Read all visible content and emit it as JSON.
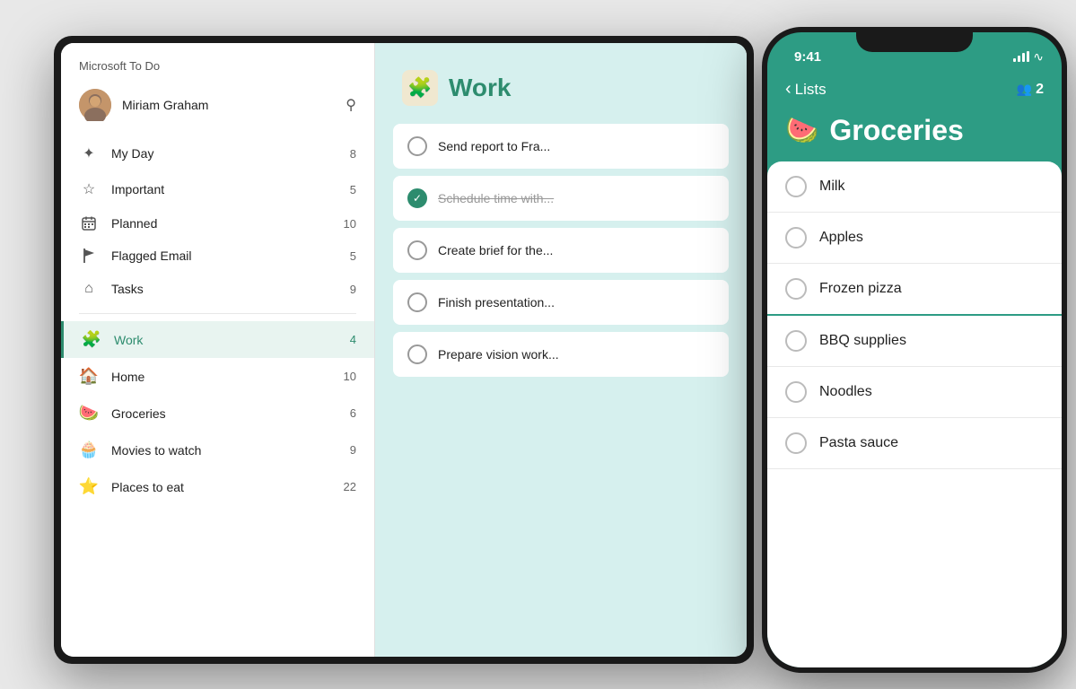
{
  "app": {
    "name": "Microsoft To Do"
  },
  "tablet": {
    "sidebar": {
      "header": "Microsoft To Do",
      "user": {
        "name": "Miriam Graham",
        "avatar_emoji": "👩"
      },
      "nav_items": [
        {
          "id": "my-day",
          "label": "My Day",
          "count": "8",
          "icon": "☀",
          "active": false
        },
        {
          "id": "important",
          "label": "Important",
          "count": "5",
          "icon": "☆",
          "active": false
        },
        {
          "id": "planned",
          "label": "Planned",
          "count": "10",
          "icon": "📅",
          "active": false
        },
        {
          "id": "flagged-email",
          "label": "Flagged Email",
          "count": "5",
          "icon": "🚩",
          "active": false
        },
        {
          "id": "tasks",
          "label": "Tasks",
          "count": "9",
          "icon": "🏠",
          "active": false
        }
      ],
      "list_items": [
        {
          "id": "work",
          "label": "Work",
          "count": "4",
          "emoji": "🧩",
          "active": true
        },
        {
          "id": "home",
          "label": "Home",
          "count": "10",
          "emoji": "🏠",
          "active": false
        },
        {
          "id": "groceries",
          "label": "Groceries",
          "count": "6",
          "emoji": "🍉",
          "active": false
        },
        {
          "id": "movies",
          "label": "Movies to watch",
          "count": "9",
          "emoji": "🧁",
          "active": false
        },
        {
          "id": "places",
          "label": "Places to eat",
          "count": "22",
          "emoji": "🌟",
          "active": false
        }
      ]
    },
    "work_list": {
      "title": "Work",
      "icon_emoji": "🧩",
      "tasks": [
        {
          "id": 1,
          "text": "Send report to Fra...",
          "completed": false
        },
        {
          "id": 2,
          "text": "Schedule time with...",
          "completed": true
        },
        {
          "id": 3,
          "text": "Create brief for the...",
          "completed": false
        },
        {
          "id": 4,
          "text": "Finish presentation...",
          "completed": false
        },
        {
          "id": 5,
          "text": "Prepare vision work...",
          "completed": false
        }
      ]
    }
  },
  "phone": {
    "status_bar": {
      "time": "9:41",
      "signal": "●●●",
      "wifi": "wifi"
    },
    "nav": {
      "back_label": "Lists",
      "people_count": "2"
    },
    "groceries": {
      "title": "Groceries",
      "emoji": "🍉",
      "items": [
        {
          "id": 1,
          "text": "Milk"
        },
        {
          "id": 2,
          "text": "Apples"
        },
        {
          "id": 3,
          "text": "Frozen pizza"
        },
        {
          "id": 4,
          "text": "BBQ supplies"
        },
        {
          "id": 5,
          "text": "Noodles"
        },
        {
          "id": 6,
          "text": "Pasta sauce"
        }
      ]
    }
  }
}
